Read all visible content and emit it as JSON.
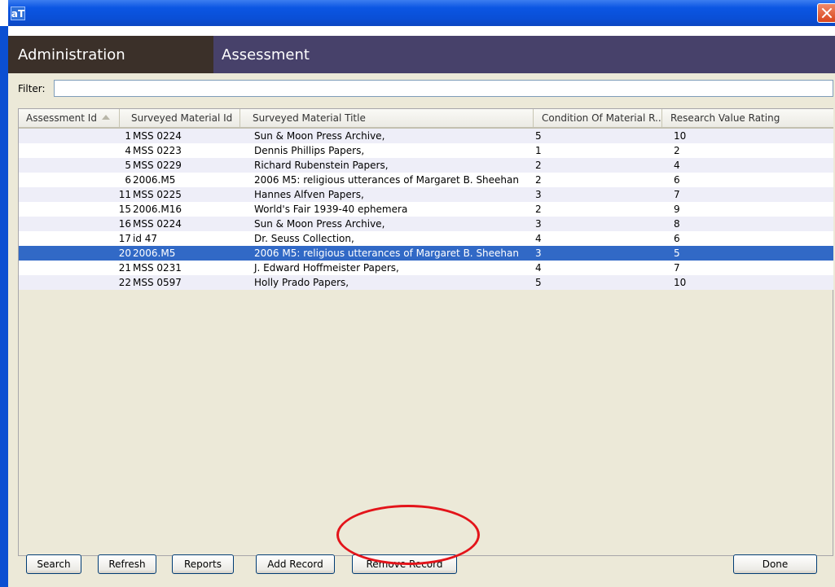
{
  "window": {
    "app_icon_text": "aT"
  },
  "header": {
    "tab_admin": "Administration",
    "tab_assessment": "Assessment"
  },
  "filter": {
    "label": "Filter:",
    "value": ""
  },
  "table": {
    "columns": [
      "Assessment Id",
      "Surveyed Material Id",
      "Surveyed Material Title",
      "Condition Of Material R...",
      "Research Value Rating"
    ],
    "sorted_column": "Assessment Id",
    "selected_row_index": 8,
    "rows": [
      [
        "1",
        "MSS 0224",
        "Sun & Moon Press Archive,",
        "5",
        "10"
      ],
      [
        "4",
        "MSS 0223",
        "Dennis Phillips Papers,",
        "1",
        "2"
      ],
      [
        "5",
        "MSS 0229",
        "Richard Rubenstein Papers,",
        "2",
        "4"
      ],
      [
        "6",
        "2006.M5",
        "2006 M5: religious utterances of Margaret B. Sheehan",
        "2",
        "6"
      ],
      [
        "11",
        "MSS 0225",
        "Hannes Alfven Papers,",
        "3",
        "7"
      ],
      [
        "15",
        "2006.M16",
        "World's Fair 1939-40 ephemera",
        "2",
        "9"
      ],
      [
        "16",
        "MSS 0224",
        "Sun & Moon Press Archive,",
        "3",
        "8"
      ],
      [
        "17",
        "id 47",
        "Dr. Seuss Collection,",
        "4",
        "6"
      ],
      [
        "20",
        "2006.M5",
        "2006 M5: religious utterances of Margaret B. Sheehan",
        "3",
        "5"
      ],
      [
        "21",
        "MSS 0231",
        "J. Edward Hoffmeister Papers,",
        "4",
        "7"
      ],
      [
        "22",
        "MSS 0597",
        "Holly Prado Papers,",
        "5",
        "10"
      ]
    ]
  },
  "buttons": {
    "search": "Search",
    "refresh": "Refresh",
    "reports": "Reports",
    "add_record": "Add Record",
    "remove_record": "Remove Record",
    "done": "Done"
  },
  "colors": {
    "selection": "#3169c6",
    "annotation_ring": "#e3141a",
    "header_bar": "#47416a"
  }
}
